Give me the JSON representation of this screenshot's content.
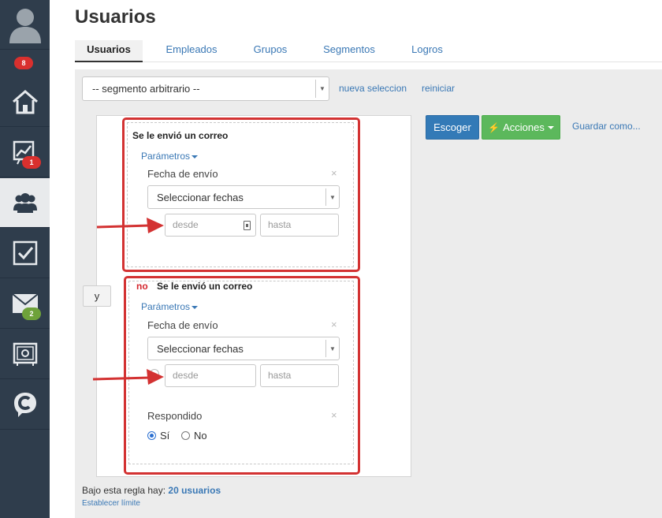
{
  "sidebar": {
    "items": [
      {
        "name": "user-avatar-icon",
        "badge": "8",
        "badge_color": "#d9302e"
      },
      {
        "name": "home-icon"
      },
      {
        "name": "chart-icon",
        "badge": "1",
        "badge_color": "#d9302e"
      },
      {
        "name": "users-group-icon",
        "active": true
      },
      {
        "name": "checkbox-icon"
      },
      {
        "name": "mail-icon",
        "badge": "2",
        "badge_color": "#6ea23a"
      },
      {
        "name": "safe-icon"
      },
      {
        "name": "c-logo-icon"
      }
    ]
  },
  "header": {
    "title": "Usuarios",
    "tabs": [
      {
        "label": "Usuarios",
        "active": true
      },
      {
        "label": "Empleados"
      },
      {
        "label": "Grupos"
      },
      {
        "label": "Segmentos"
      },
      {
        "label": "Logros"
      }
    ]
  },
  "segment": {
    "selected": "-- segmento arbitrario --",
    "new_selection": "nueva seleccion",
    "reset": "reiniciar"
  },
  "actions": {
    "choose": "Escoger",
    "actions": "Acciones",
    "save_as": "Guardar como..."
  },
  "rules": {
    "connector": "y",
    "rule1": {
      "title": "Se le envió un correo",
      "params": "Parámetros",
      "field_label": "Fecha de envío",
      "dates_select": "Seleccionar fechas",
      "from_placeholder": "desde",
      "to_placeholder": "hasta"
    },
    "rule2": {
      "negation": "no",
      "title": "Se le envió un correo",
      "params": "Parámetros",
      "field_label": "Fecha de envío",
      "dates_select": "Seleccionar fechas",
      "from_placeholder": "desde",
      "to_placeholder": "hasta",
      "answered_label": "Respondido",
      "yes": "Sí",
      "no": "No",
      "answered_value": "Sí"
    }
  },
  "footer": {
    "rule_count_prefix": "Bajo esta regla hay:",
    "rule_count": "20 usuarios",
    "set_limit": "Establecer límite"
  },
  "colors": {
    "sidebar_bg": "#2f3d4c",
    "accent_blue": "#337ab7",
    "accent_green": "#5cb85c",
    "highlight_red": "#d33232"
  }
}
